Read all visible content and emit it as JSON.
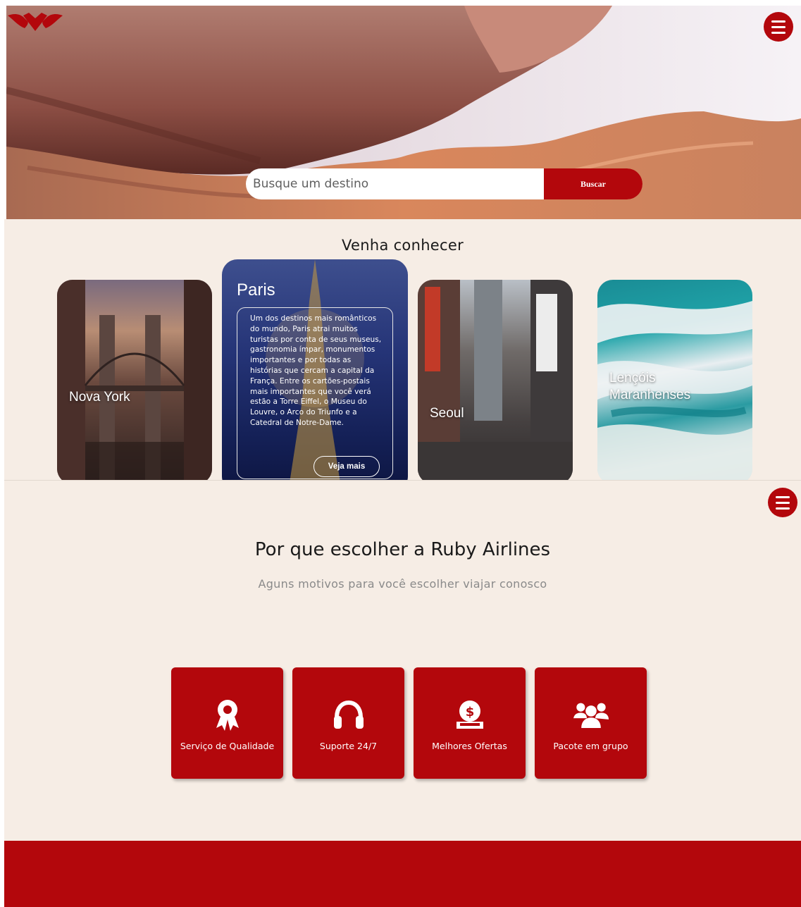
{
  "header": {
    "logo_icon": "ruby-wings-logo",
    "menu_icon": "hamburger-menu-icon"
  },
  "search": {
    "placeholder": "Busque um destino",
    "button_label": "Buscar"
  },
  "destinations": {
    "title": "Venha conhecer",
    "cards": [
      {
        "name": "Nova York"
      },
      {
        "name": "Paris",
        "description": "Um dos destinos mais românticos do mundo, Paris atrai muitos turistas por conta de seus museus, gastronomia ímpar, monumentos importantes e por todas as histórias que cercam a capital da França. Entre os cartões-postais mais importantes que você verá estão a Torre Eiffel, o Museu do Louvre, o Arco do Triunfo e a Catedral de Notre-Dame.",
        "button_label": "Veja mais"
      },
      {
        "name": "Seoul"
      },
      {
        "name": "Lençóis\nMaranhenses"
      }
    ]
  },
  "why": {
    "title": "Por que escolher a Ruby Airlines",
    "subtitle": "Aguns motivos para você escolher viajar conosco",
    "features": [
      {
        "label": "Serviço de Qualidade",
        "icon": "award-ribbon-icon"
      },
      {
        "label": "Suporte 24/7",
        "icon": "headphones-icon"
      },
      {
        "label": "Melhores Ofertas",
        "icon": "money-hand-icon"
      },
      {
        "label": "Pacote em grupo",
        "icon": "group-users-icon"
      }
    ]
  },
  "colors": {
    "brand_red": "#b3070c",
    "section_bg": "#f6ede5"
  }
}
